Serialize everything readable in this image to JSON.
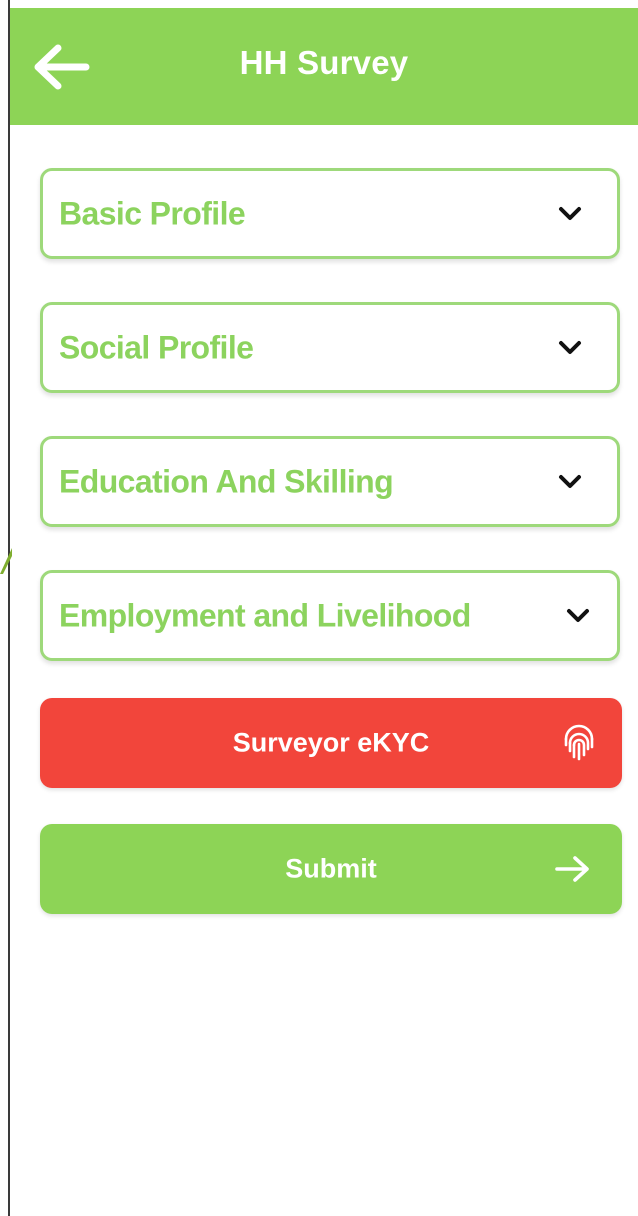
{
  "header": {
    "title": "HH Survey",
    "back_icon": "arrow-left-icon",
    "background": "#8dd456"
  },
  "sections": [
    {
      "label": "Basic Profile",
      "icon": "chevron-down-icon"
    },
    {
      "label": "Social Profile",
      "icon": "chevron-down-icon"
    },
    {
      "label": "Education And Skilling",
      "icon": "chevron-down-icon"
    },
    {
      "label": "Employment and Livelihood",
      "icon": "chevron-down-icon"
    }
  ],
  "ekyc_button": {
    "label": "Surveyor eKYC",
    "icon": "fingerprint-icon",
    "color": "#f2453b"
  },
  "submit_button": {
    "label": "Submit",
    "icon": "arrow-right-icon",
    "color": "#8dd456"
  },
  "colors": {
    "accent": "#8dd456",
    "section_text": "#8cd35e",
    "section_border": "#9ed97b"
  }
}
